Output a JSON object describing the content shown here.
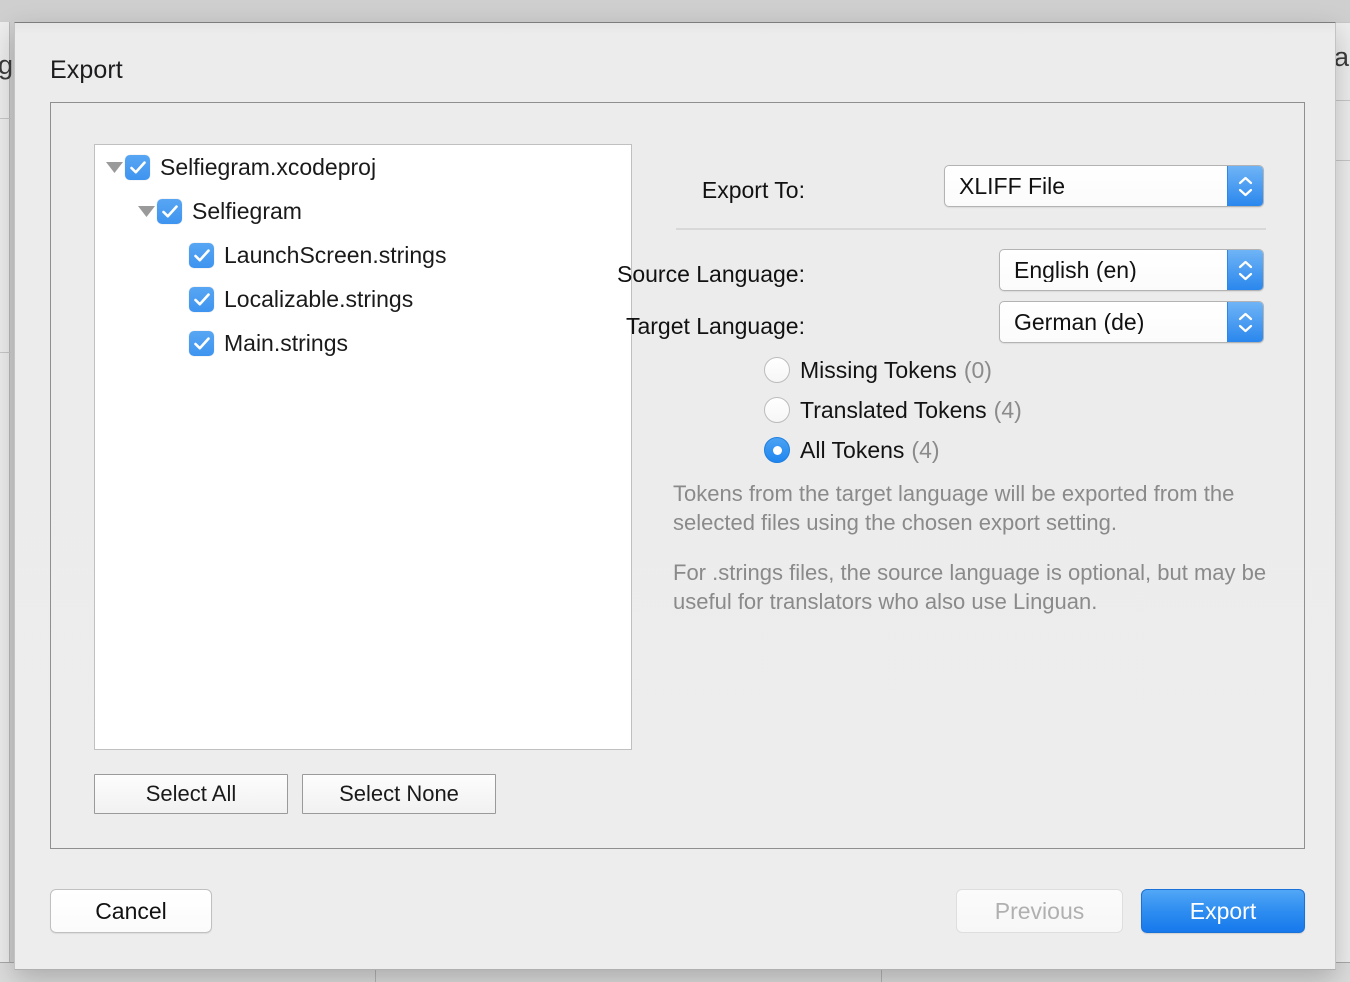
{
  "sheet": {
    "title": "Export"
  },
  "tree": {
    "rows": [
      {
        "label": "Selfiegram.xcodeproj",
        "indent": 0,
        "disclosure": "triangle-down-icon",
        "checked": true
      },
      {
        "label": "Selfiegram",
        "indent": 1,
        "disclosure": "triangle-down-icon",
        "checked": true
      },
      {
        "label": "LaunchScreen.strings",
        "indent": 2,
        "disclosure": "none",
        "checked": true
      },
      {
        "label": "Localizable.strings",
        "indent": 2,
        "disclosure": "none",
        "checked": true
      },
      {
        "label": "Main.strings",
        "indent": 2,
        "disclosure": "none",
        "checked": true
      }
    ],
    "select_all_label": "Select All",
    "select_none_label": "Select None"
  },
  "options": {
    "export_to_label": "Export To:",
    "export_to_value": "XLIFF File",
    "source_language_label": "Source Language:",
    "source_language_value": "English (en)",
    "target_language_label": "Target Language:",
    "target_language_value": "German (de)",
    "stepper_icon": "stepper-updown-icon",
    "tokens": [
      {
        "label": "Missing Tokens",
        "count": "(0)",
        "selected": false
      },
      {
        "label": "Translated Tokens",
        "count": "(4)",
        "selected": false
      },
      {
        "label": "All Tokens",
        "count": "(4)",
        "selected": true
      }
    ],
    "help_paragraph_1": "Tokens from the target language will be exported from the selected files using the chosen export setting.",
    "help_paragraph_2": "For .strings files, the source language is optional, but may be useful for translators who also use Linguan."
  },
  "footer": {
    "cancel_label": "Cancel",
    "previous_label": "Previous",
    "export_label": "Export"
  },
  "backdrop": {
    "left_glyph": "g",
    "right_glyph": "a"
  },
  "colors": {
    "accent_blue": "#2e8df0",
    "checkbox_blue": "#4a9bee",
    "sheet_bg": "#ededed",
    "muted_text": "#8a8a8a",
    "disabled_text": "#b0b0b0"
  }
}
